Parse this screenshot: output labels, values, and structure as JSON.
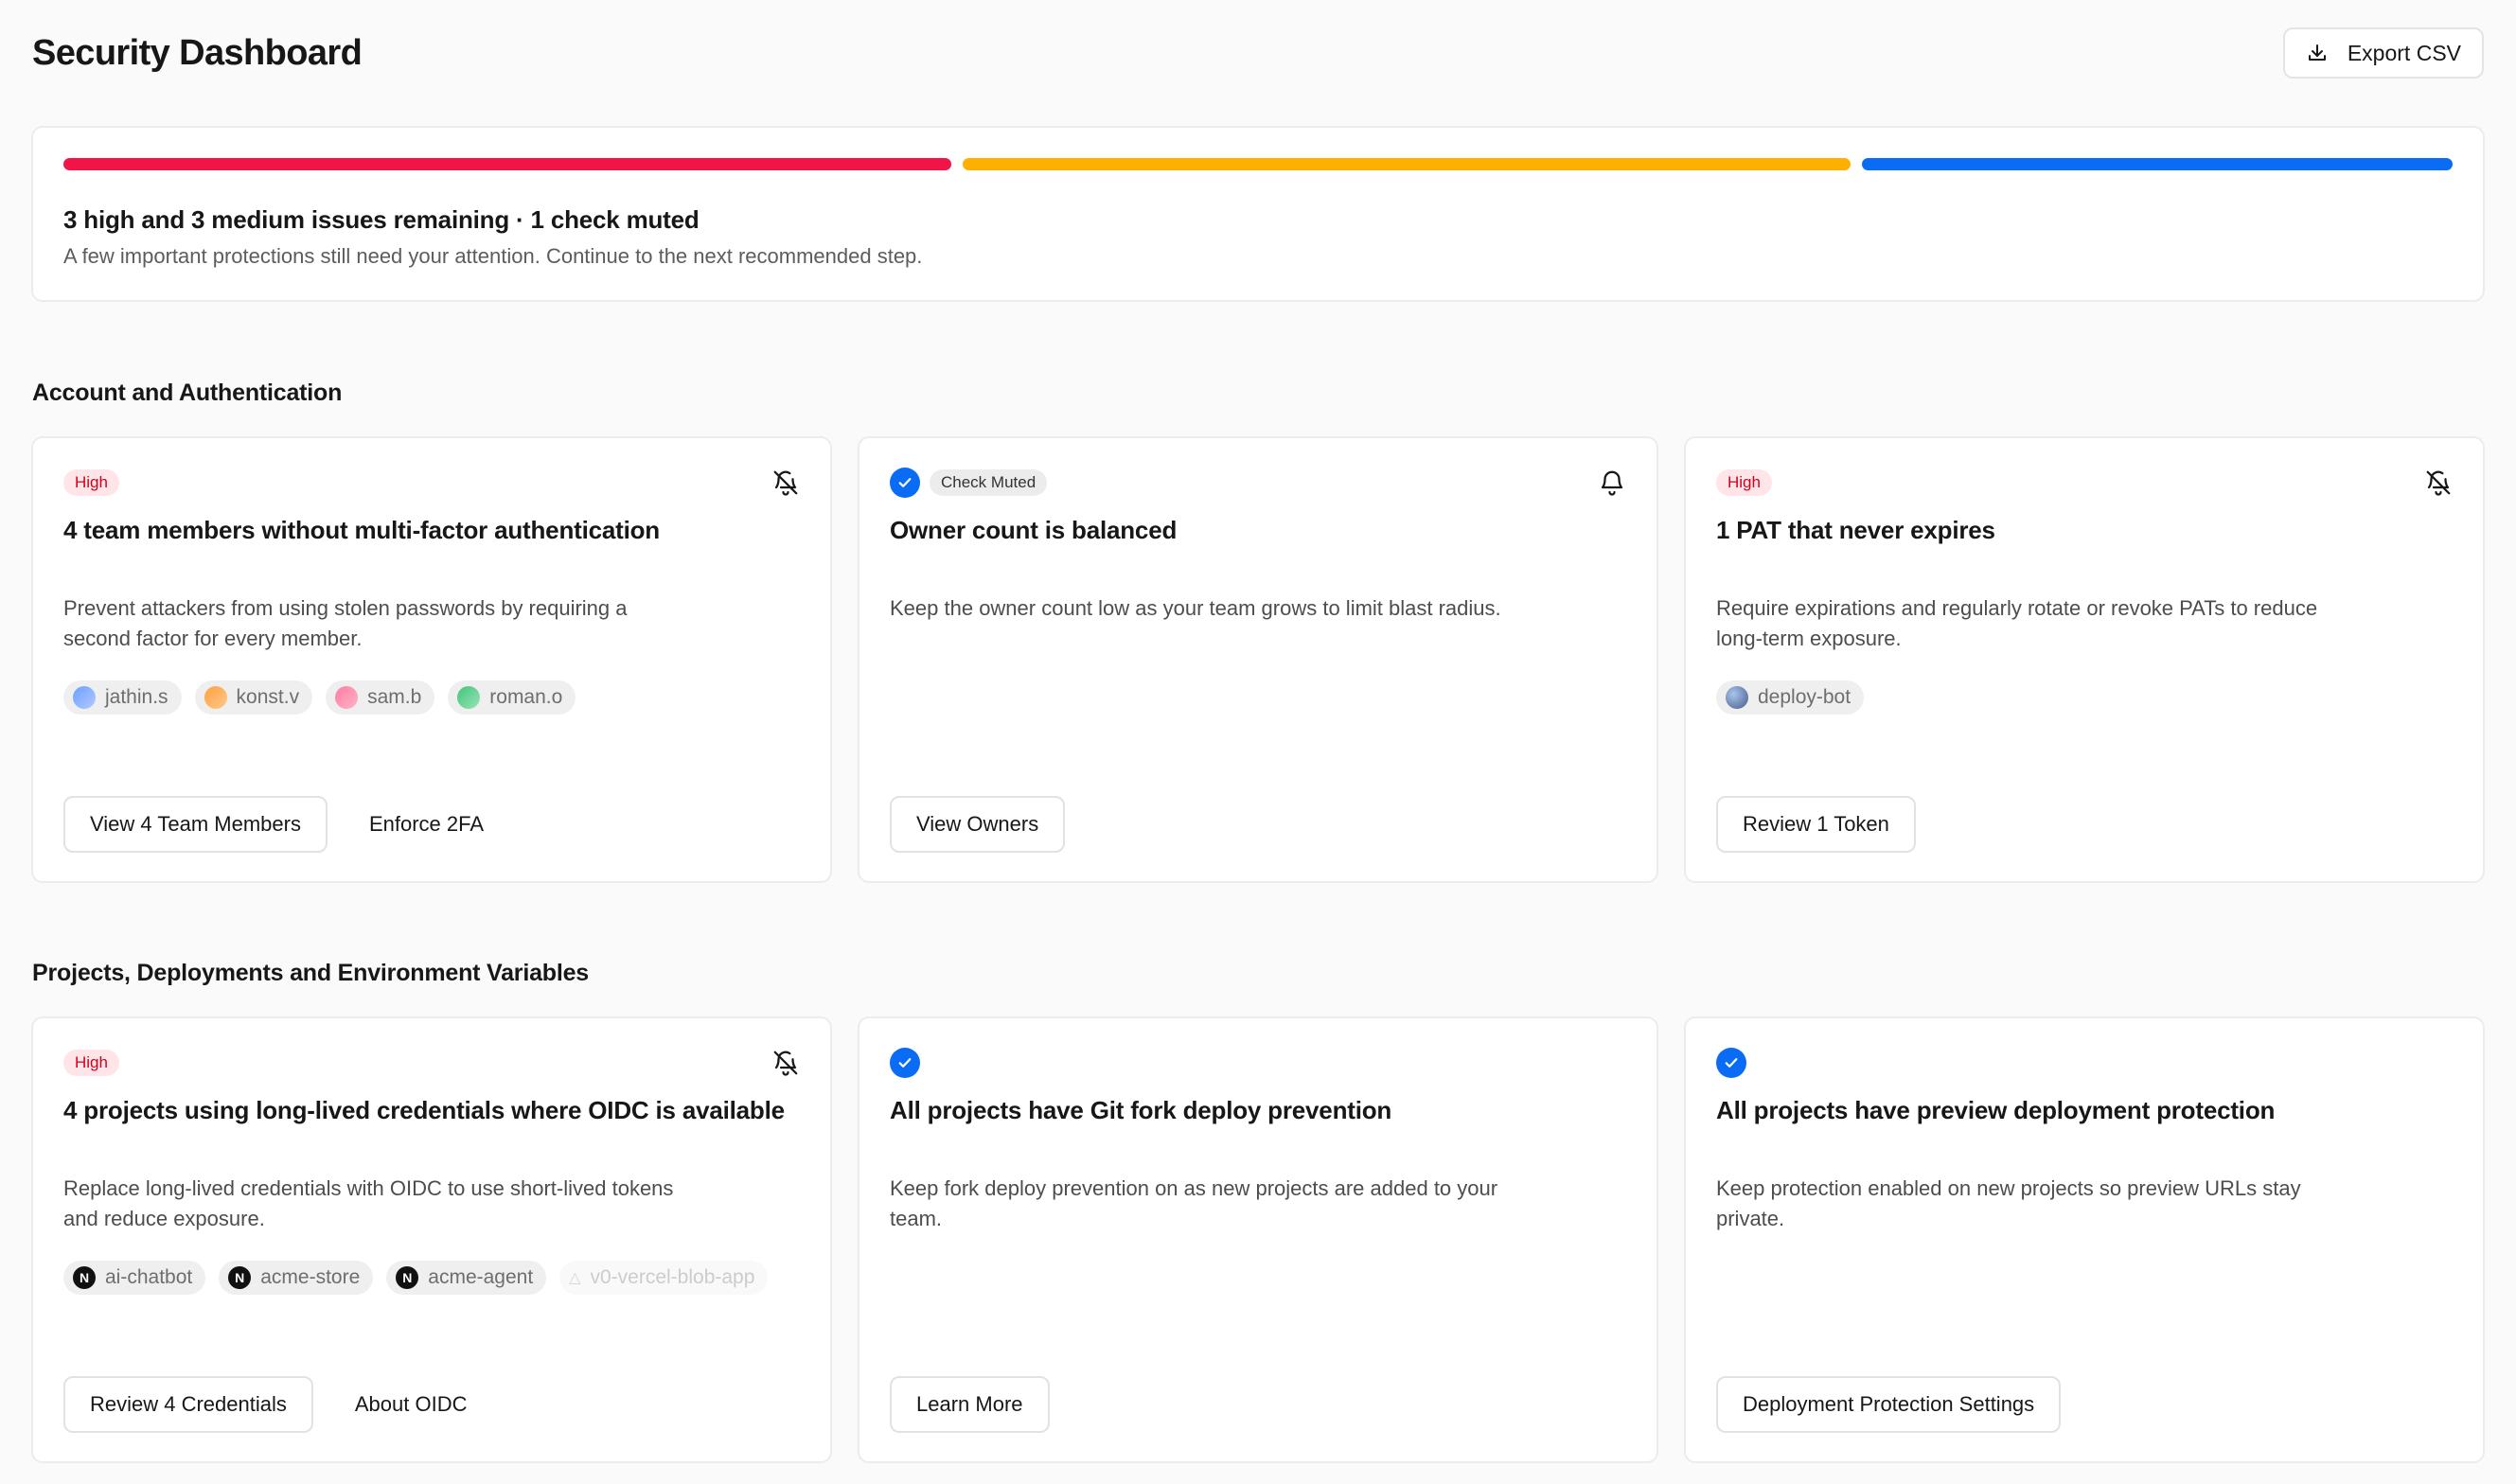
{
  "header": {
    "title": "Security Dashboard",
    "export_label": "Export CSV"
  },
  "summary": {
    "title": "3 high and 3 medium issues remaining · 1 check muted",
    "description": "A few important protections still need your attention. Continue to the next recommended step.",
    "colors": {
      "high": "#f01546",
      "medium": "#ffaf00",
      "low": "#0a6cf5"
    }
  },
  "sections": [
    {
      "title": "Account and Authentication",
      "cards": [
        {
          "badge": "High",
          "title": "4 team members without multi-factor authentication",
          "description": "Prevent attackers from using stolen passwords by requiring a second factor for every member.",
          "chips": [
            "jathin.s",
            "konst.v",
            "sam.b",
            "roman.o"
          ],
          "primary": "View 4 Team Members",
          "secondary": "Enforce 2FA",
          "icon": "bell-off-icon"
        },
        {
          "badge": "Check Muted",
          "title": "Owner count is balanced",
          "description": "Keep the owner count low as your team grows to limit blast radius.",
          "primary": "View Owners",
          "icon": "bell-icon"
        },
        {
          "badge": "High",
          "title": "1 PAT that never expires",
          "description": "Require expirations and regularly rotate or revoke PATs to reduce long-term exposure.",
          "chips": [
            "deploy-bot"
          ],
          "primary": "Review 1 Token",
          "icon": "bell-off-icon"
        }
      ]
    },
    {
      "title": "Projects, Deployments and Environment Variables",
      "cards": [
        {
          "badge": "High",
          "title": "4 projects using long-lived credentials where OIDC is available",
          "description": "Replace long-lived credentials with OIDC to use short-lived tokens and reduce exposure.",
          "chips": [
            "ai-chatbot",
            "acme-store",
            "acme-agent",
            "v0-vercel-blob-app"
          ],
          "primary": "Review 4 Credentials",
          "secondary": "About OIDC",
          "icon": "bell-off-icon"
        },
        {
          "title": "All projects have Git fork deploy prevention",
          "description": "Keep fork deploy prevention on as new projects are added to your team.",
          "primary": "Learn More"
        },
        {
          "title": "All projects have preview deployment protection",
          "description": "Keep protection enabled on new projects so preview URLs stay private.",
          "primary": "Deployment Protection Settings"
        }
      ]
    }
  ]
}
